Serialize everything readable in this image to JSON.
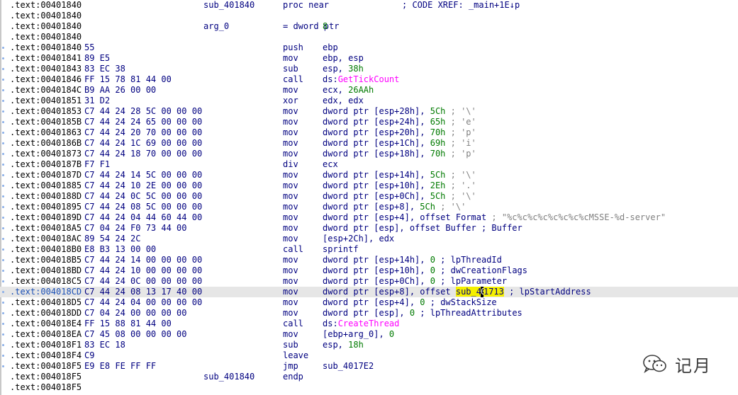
{
  "rows": [
    {
      "addr": ".text:00401840",
      "bytes": "",
      "name": "sub_401840",
      "mnem": "proc near",
      "ops": [],
      "comment": "; CODE XREF: _main+1E↓p",
      "hl": false,
      "dot": false
    },
    {
      "addr": ".text:00401840",
      "bytes": "",
      "name": "",
      "mnem": "",
      "ops": [],
      "hl": false,
      "dot": false
    },
    {
      "addr": ".text:00401840",
      "bytes": "",
      "name": "arg_0",
      "mnem": "= dword ptr",
      "ops": [
        {
          "t": "8",
          "c": "num"
        }
      ],
      "hl": false,
      "dot": false
    },
    {
      "addr": ".text:00401840",
      "bytes": "",
      "name": "",
      "mnem": "",
      "ops": [],
      "hl": false,
      "dot": false
    },
    {
      "addr": ".text:00401840",
      "bytes": "55",
      "name": "",
      "mnem": "push",
      "ops": [
        {
          "t": "ebp"
        }
      ],
      "hl": false,
      "dot": true
    },
    {
      "addr": ".text:00401841",
      "bytes": "89 E5",
      "name": "",
      "mnem": "mov",
      "ops": [
        {
          "t": "ebp, esp"
        }
      ],
      "hl": false,
      "dot": true
    },
    {
      "addr": ".text:00401843",
      "bytes": "83 EC 38",
      "name": "",
      "mnem": "sub",
      "ops": [
        {
          "t": "esp, "
        },
        {
          "t": "38h",
          "c": "num"
        }
      ],
      "hl": false,
      "dot": true
    },
    {
      "addr": ".text:00401846",
      "bytes": "FF 15 78 81 44 00",
      "name": "",
      "mnem": "call",
      "ops": [
        {
          "t": "ds:"
        },
        {
          "t": "GetTickCount",
          "c": "func"
        }
      ],
      "hl": false,
      "dot": true
    },
    {
      "addr": ".text:0040184C",
      "bytes": "B9 AA 26 00 00",
      "name": "",
      "mnem": "mov",
      "ops": [
        {
          "t": "ecx, "
        },
        {
          "t": "26AAh",
          "c": "num"
        }
      ],
      "hl": false,
      "dot": true
    },
    {
      "addr": ".text:00401851",
      "bytes": "31 D2",
      "name": "",
      "mnem": "xor",
      "ops": [
        {
          "t": "edx, edx"
        }
      ],
      "hl": false,
      "dot": true
    },
    {
      "addr": ".text:00401853",
      "bytes": "C7 44 24 28 5C 00 00 00",
      "name": "",
      "mnem": "mov",
      "ops": [
        {
          "t": "dword ptr [esp+28h], "
        },
        {
          "t": "5Ch",
          "c": "num"
        },
        {
          "t": " ; '\\'",
          "c": "cmt"
        }
      ],
      "hl": false,
      "dot": true
    },
    {
      "addr": ".text:0040185B",
      "bytes": "C7 44 24 24 65 00 00 00",
      "name": "",
      "mnem": "mov",
      "ops": [
        {
          "t": "dword ptr [esp+24h], "
        },
        {
          "t": "65h",
          "c": "num"
        },
        {
          "t": " ; 'e'",
          "c": "cmt"
        }
      ],
      "hl": false,
      "dot": true
    },
    {
      "addr": ".text:00401863",
      "bytes": "C7 44 24 20 70 00 00 00",
      "name": "",
      "mnem": "mov",
      "ops": [
        {
          "t": "dword ptr [esp+20h], "
        },
        {
          "t": "70h",
          "c": "num"
        },
        {
          "t": " ; 'p'",
          "c": "cmt"
        }
      ],
      "hl": false,
      "dot": true
    },
    {
      "addr": ".text:0040186B",
      "bytes": "C7 44 24 1C 69 00 00 00",
      "name": "",
      "mnem": "mov",
      "ops": [
        {
          "t": "dword ptr [esp+1Ch], "
        },
        {
          "t": "69h",
          "c": "num"
        },
        {
          "t": " ; 'i'",
          "c": "cmt"
        }
      ],
      "hl": false,
      "dot": true
    },
    {
      "addr": ".text:00401873",
      "bytes": "C7 44 24 18 70 00 00 00",
      "name": "",
      "mnem": "mov",
      "ops": [
        {
          "t": "dword ptr [esp+18h], "
        },
        {
          "t": "70h",
          "c": "num"
        },
        {
          "t": " ; 'p'",
          "c": "cmt"
        }
      ],
      "hl": false,
      "dot": true
    },
    {
      "addr": ".text:0040187B",
      "bytes": "F7 F1",
      "name": "",
      "mnem": "div",
      "ops": [
        {
          "t": "ecx"
        }
      ],
      "hl": false,
      "dot": true
    },
    {
      "addr": ".text:0040187D",
      "bytes": "C7 44 24 14 5C 00 00 00",
      "name": "",
      "mnem": "mov",
      "ops": [
        {
          "t": "dword ptr [esp+14h], "
        },
        {
          "t": "5Ch",
          "c": "num"
        },
        {
          "t": " ; '\\'",
          "c": "cmt"
        }
      ],
      "hl": false,
      "dot": true
    },
    {
      "addr": ".text:00401885",
      "bytes": "C7 44 24 10 2E 00 00 00",
      "name": "",
      "mnem": "mov",
      "ops": [
        {
          "t": "dword ptr [esp+10h], "
        },
        {
          "t": "2Eh",
          "c": "num"
        },
        {
          "t": " ; '.'",
          "c": "cmt"
        }
      ],
      "hl": false,
      "dot": true
    },
    {
      "addr": ".text:0040188D",
      "bytes": "C7 44 24 0C 5C 00 00 00",
      "name": "",
      "mnem": "mov",
      "ops": [
        {
          "t": "dword ptr [esp+0Ch], "
        },
        {
          "t": "5Ch",
          "c": "num"
        },
        {
          "t": " ; '\\'",
          "c": "cmt"
        }
      ],
      "hl": false,
      "dot": true
    },
    {
      "addr": ".text:00401895",
      "bytes": "C7 44 24 08 5C 00 00 00",
      "name": "",
      "mnem": "mov",
      "ops": [
        {
          "t": "dword ptr [esp+8], "
        },
        {
          "t": "5Ch",
          "c": "num"
        },
        {
          "t": " ; '\\'",
          "c": "cmt"
        }
      ],
      "hl": false,
      "dot": true
    },
    {
      "addr": ".text:0040189D",
      "bytes": "C7 44 24 04 44 60 44 00",
      "name": "",
      "mnem": "mov",
      "ops": [
        {
          "t": "dword ptr [esp+4], offset Format"
        },
        {
          "t": " ; \"%c%c%c%c%c%c%c%cMSSE-%d-server\"",
          "c": "str"
        }
      ],
      "hl": false,
      "dot": true
    },
    {
      "addr": ".text:004018A5",
      "bytes": "C7 04 24 F0 73 44 00",
      "name": "",
      "mnem": "mov",
      "ops": [
        {
          "t": "dword ptr [esp], offset Buffer ; Buffer"
        }
      ],
      "hl": false,
      "dot": true
    },
    {
      "addr": ".text:004018AC",
      "bytes": "89 54 24 2C",
      "name": "",
      "mnem": "mov",
      "ops": [
        {
          "t": "[esp+2Ch], edx"
        }
      ],
      "hl": false,
      "dot": true
    },
    {
      "addr": ".text:004018B0",
      "bytes": "E8 B3 13 00 00",
      "name": "",
      "mnem": "call",
      "ops": [
        {
          "t": "sprintf"
        }
      ],
      "hl": false,
      "dot": true
    },
    {
      "addr": ".text:004018B5",
      "bytes": "C7 44 24 14 00 00 00 00",
      "name": "",
      "mnem": "mov",
      "ops": [
        {
          "t": "dword ptr [esp+14h], "
        },
        {
          "t": "0",
          "c": "num"
        },
        {
          "t": " ; lpThreadId"
        }
      ],
      "hl": false,
      "dot": true
    },
    {
      "addr": ".text:004018BD",
      "bytes": "C7 44 24 10 00 00 00 00",
      "name": "",
      "mnem": "mov",
      "ops": [
        {
          "t": "dword ptr [esp+10h], "
        },
        {
          "t": "0",
          "c": "num"
        },
        {
          "t": " ; dwCreationFlags"
        }
      ],
      "hl": false,
      "dot": true
    },
    {
      "addr": ".text:004018C5",
      "bytes": "C7 44 24 0C 00 00 00 00",
      "name": "",
      "mnem": "mov",
      "ops": [
        {
          "t": "dword ptr [esp+0Ch], "
        },
        {
          "t": "0",
          "c": "num"
        },
        {
          "t": " ; lpParameter"
        }
      ],
      "hl": false,
      "dot": true
    },
    {
      "addr": ".text:004018CD",
      "bytes": "C7 44 24 08 13 17 40 00",
      "name": "",
      "mnem": "mov",
      "ops": [
        {
          "t": "dword ptr [esp+8], offset "
        },
        {
          "t": "sub_4",
          "c": "symhl"
        },
        {
          "t": "0",
          "c": "cursor"
        },
        {
          "t": "1713",
          "c": "symhl"
        },
        {
          "t": " ; lpStartAddress"
        }
      ],
      "hl": true,
      "dot": true
    },
    {
      "addr": ".text:004018D5",
      "bytes": "C7 44 24 04 00 00 00 00",
      "name": "",
      "mnem": "mov",
      "ops": [
        {
          "t": "dword ptr [esp+4], "
        },
        {
          "t": "0",
          "c": "num"
        },
        {
          "t": " ; dwStackSize"
        }
      ],
      "hl": false,
      "dot": true
    },
    {
      "addr": ".text:004018DD",
      "bytes": "C7 04 24 00 00 00 00",
      "name": "",
      "mnem": "mov",
      "ops": [
        {
          "t": "dword ptr [esp], "
        },
        {
          "t": "0",
          "c": "num"
        },
        {
          "t": " ; lpThreadAttributes"
        }
      ],
      "hl": false,
      "dot": true
    },
    {
      "addr": ".text:004018E4",
      "bytes": "FF 15 88 81 44 00",
      "name": "",
      "mnem": "call",
      "ops": [
        {
          "t": "ds:"
        },
        {
          "t": "CreateThread",
          "c": "func"
        }
      ],
      "hl": false,
      "dot": true
    },
    {
      "addr": ".text:004018EA",
      "bytes": "C7 45 08 00 00 00 00",
      "name": "",
      "mnem": "mov",
      "ops": [
        {
          "t": "[ebp+arg_0], "
        },
        {
          "t": "0",
          "c": "num"
        }
      ],
      "hl": false,
      "dot": true
    },
    {
      "addr": ".text:004018F1",
      "bytes": "83 EC 18",
      "name": "",
      "mnem": "sub",
      "ops": [
        {
          "t": "esp, "
        },
        {
          "t": "18h",
          "c": "num"
        }
      ],
      "hl": false,
      "dot": true
    },
    {
      "addr": ".text:004018F4",
      "bytes": "C9",
      "name": "",
      "mnem": "leave",
      "ops": [],
      "hl": false,
      "dot": true
    },
    {
      "addr": ".text:004018F5",
      "bytes": "E9 E8 FE FF FF",
      "name": "",
      "mnem": "jmp",
      "ops": [
        {
          "t": "sub_4017E2"
        }
      ],
      "hl": false,
      "dot": true
    },
    {
      "addr": ".text:004018F5",
      "bytes": "",
      "name": "sub_401840",
      "mnem": "endp",
      "ops": [],
      "hl": false,
      "dot": false
    },
    {
      "addr": ".text:004018F5",
      "bytes": "",
      "name": "",
      "mnem": "",
      "ops": [],
      "hl": false,
      "dot": false
    }
  ],
  "watermark": {
    "text": "记月",
    "icon": "wechat-icon"
  },
  "colors": {
    "highlight": "#f5f000",
    "code": "#000080",
    "number": "#007a00",
    "import": "#ff00ff",
    "comment": "#808080"
  }
}
